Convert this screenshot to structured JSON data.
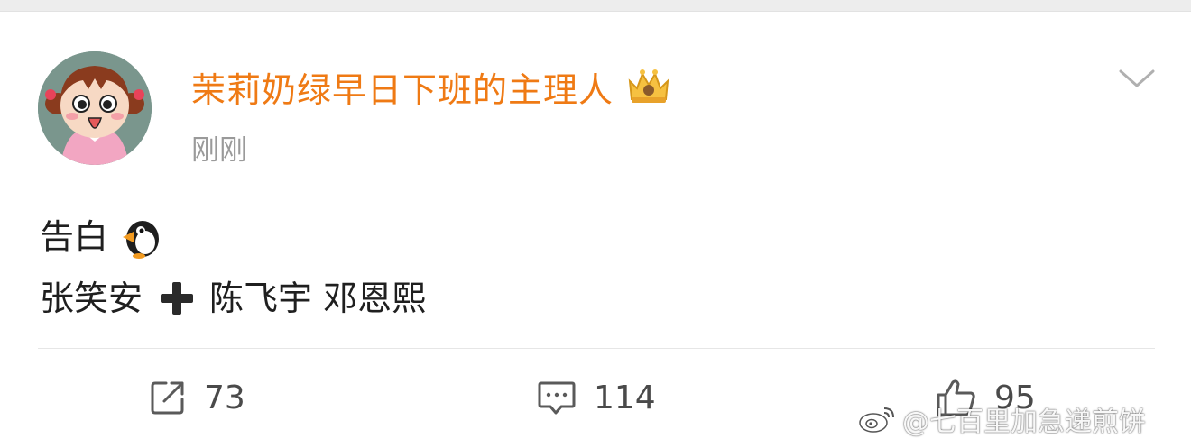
{
  "post": {
    "author": {
      "name": "茉莉奶绿早日下班的主理人",
      "name_color": "#ef7a14",
      "badge_icon": "vip-crown-icon"
    },
    "time": "刚刚",
    "menu_icon": "chevron-down-icon",
    "content": {
      "line1_text": "告白",
      "line1_emoji": "penguin-icon",
      "line2_name1": "张笑安",
      "line2_emoji": "plus-icon",
      "line2_rest": "陈飞宇 邓恩熙"
    },
    "actions": {
      "repost_count": "73",
      "comment_count": "114",
      "like_count": "95"
    }
  },
  "watermark": {
    "text": "@七百里加急递煎饼",
    "icon": "weibo-logo-icon"
  }
}
